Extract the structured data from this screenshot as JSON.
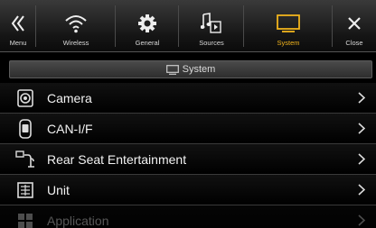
{
  "topbar": {
    "items": [
      {
        "label": "Menu",
        "icon": "double-chevron-left-icon"
      },
      {
        "label": "Wireless",
        "icon": "wifi-icon"
      },
      {
        "label": "General",
        "icon": "gear-icon"
      },
      {
        "label": "Sources",
        "icon": "music-note-icon"
      },
      {
        "label": "System",
        "icon": "monitor-icon"
      },
      {
        "label": "Close",
        "icon": "close-icon"
      }
    ],
    "active": "System",
    "accent_color": "#f1b31c"
  },
  "section": {
    "title": "System",
    "icon": "monitor-icon"
  },
  "list": {
    "items": [
      {
        "label": "Camera",
        "icon": "camera-icon"
      },
      {
        "label": "CAN-I/F",
        "icon": "car-fob-icon"
      },
      {
        "label": "Rear Seat Entertainment",
        "icon": "rear-seat-icon"
      },
      {
        "label": "Unit",
        "icon": "unit-grid-icon"
      },
      {
        "label": "Application",
        "icon": "application-icon"
      }
    ]
  }
}
